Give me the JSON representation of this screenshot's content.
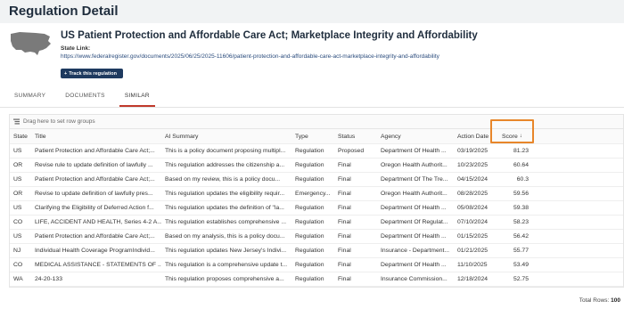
{
  "page": {
    "title": "Regulation Detail"
  },
  "regulation": {
    "title": "US Patient Protection and Affordable Care Act; Marketplace Integrity and Affordability",
    "state_link_label": "State Link:",
    "state_link_url": "https://www.federalregister.gov/documents/2025/06/25/2025-11606/patient-protection-and-affordable-care-act-marketplace-integrity-and-affordability",
    "track_button": "Track this regulation"
  },
  "tabs": [
    {
      "label": "SUMMARY"
    },
    {
      "label": "DOCUMENTS"
    },
    {
      "label": "SIMILAR",
      "active": true
    }
  ],
  "grid": {
    "group_hint": "Drag here to set row groups",
    "columns": {
      "state": "State",
      "title": "Title",
      "summary": "AI Summary",
      "type": "Type",
      "status": "Status",
      "agency": "Agency",
      "date": "Action Date",
      "score": "Score"
    },
    "rows": [
      {
        "state": "US",
        "title": "Patient Protection and Affordable Care Act;...",
        "summary": "This is a policy document proposing multipl...",
        "type": "Regulation",
        "status": "Proposed",
        "agency": "Department Of Health ...",
        "date": "03/19/2025",
        "score": "81.23"
      },
      {
        "state": "OR",
        "title": "Revise rule to update definition of lawfully ...",
        "summary": "This regulation addresses the citizenship a...",
        "type": "Regulation",
        "status": "Final",
        "agency": "Oregon Health Authorit...",
        "date": "10/23/2025",
        "score": "60.64"
      },
      {
        "state": "US",
        "title": "Patient Protection and Affordable Care Act;...",
        "summary": "Based on my review, this is a policy docu...",
        "type": "Regulation",
        "status": "Final",
        "agency": "Department Of The Tre...",
        "date": "04/15/2024",
        "score": "60.3"
      },
      {
        "state": "OR",
        "title": "Revise to update definition of lawfully pres...",
        "summary": "This regulation updates the eligibility requir...",
        "type": "Emergency...",
        "status": "Final",
        "agency": "Oregon Health Authorit...",
        "date": "08/28/2025",
        "score": "59.56"
      },
      {
        "state": "US",
        "title": "Clarifying the Eligibility of Deferred Action f...",
        "summary": "This regulation updates the definition of \"la...",
        "type": "Regulation",
        "status": "Final",
        "agency": "Department Of Health ...",
        "date": "05/08/2024",
        "score": "59.38"
      },
      {
        "state": "CO",
        "title": "LIFE, ACCIDENT AND HEALTH, Series 4-2 A...",
        "summary": "This regulation establishes comprehensive ...",
        "type": "Regulation",
        "status": "Final",
        "agency": "Department Of Regulat...",
        "date": "07/10/2024",
        "score": "58.23"
      },
      {
        "state": "US",
        "title": "Patient Protection and Affordable Care Act;...",
        "summary": "Based on my analysis, this is a policy docu...",
        "type": "Regulation",
        "status": "Final",
        "agency": "Department Of Health ...",
        "date": "01/15/2025",
        "score": "56.42"
      },
      {
        "state": "NJ",
        "title": "Individual Health Coverage ProgramIndivid...",
        "summary": "This regulation updates New Jersey's Indivi...",
        "type": "Regulation",
        "status": "Final",
        "agency": "Insurance - Department...",
        "date": "01/21/2025",
        "score": "55.77"
      },
      {
        "state": "CO",
        "title": "MEDICAL ASSISTANCE - STATEMENTS OF ...",
        "summary": "This regulation is a comprehensive update t...",
        "type": "Regulation",
        "status": "Final",
        "agency": "Department Of Health ...",
        "date": "11/10/2025",
        "score": "53.49"
      },
      {
        "state": "WA",
        "title": "24-20-133",
        "summary": "This regulation proposes comprehensive a...",
        "type": "Regulation",
        "status": "Final",
        "agency": "Insurance Commission...",
        "date": "12/18/2024",
        "score": "52.75"
      }
    ],
    "footer_label": "Total Rows:",
    "footer_count": "100",
    "sort_indicator": "↓"
  },
  "icons": {
    "map": "us-map-icon",
    "track": "plus-icon",
    "group": "row-group-icon",
    "sort": "sort-down-icon"
  },
  "colors": {
    "accent": "#1e3a5f",
    "active_tab_underline": "#c0392b",
    "highlight_box": "#e8862a"
  }
}
